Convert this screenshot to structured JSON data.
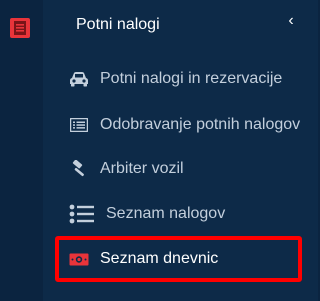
{
  "rail": {
    "icon": "notebook-icon",
    "accent": "#e8343a"
  },
  "panel": {
    "title": "Potni nalogi",
    "collapse_glyph": "‹"
  },
  "menu": {
    "items": [
      {
        "label": "Potni nalogi in rezervacije",
        "icon": "car-icon"
      },
      {
        "label": "Odobravanje potnih nalogov",
        "icon": "list-box-icon"
      },
      {
        "label": "Arbiter vozil",
        "icon": "gavel-icon"
      },
      {
        "label": "Seznam nalogov",
        "icon": "bullet-list-icon"
      },
      {
        "label": "Seznam dnevnic",
        "icon": "money-icon",
        "active": true
      }
    ]
  },
  "colors": {
    "background": "#0b2440",
    "panel": "#0d2a48",
    "text_muted": "#c3cfdc",
    "highlight": "#ff0000"
  }
}
